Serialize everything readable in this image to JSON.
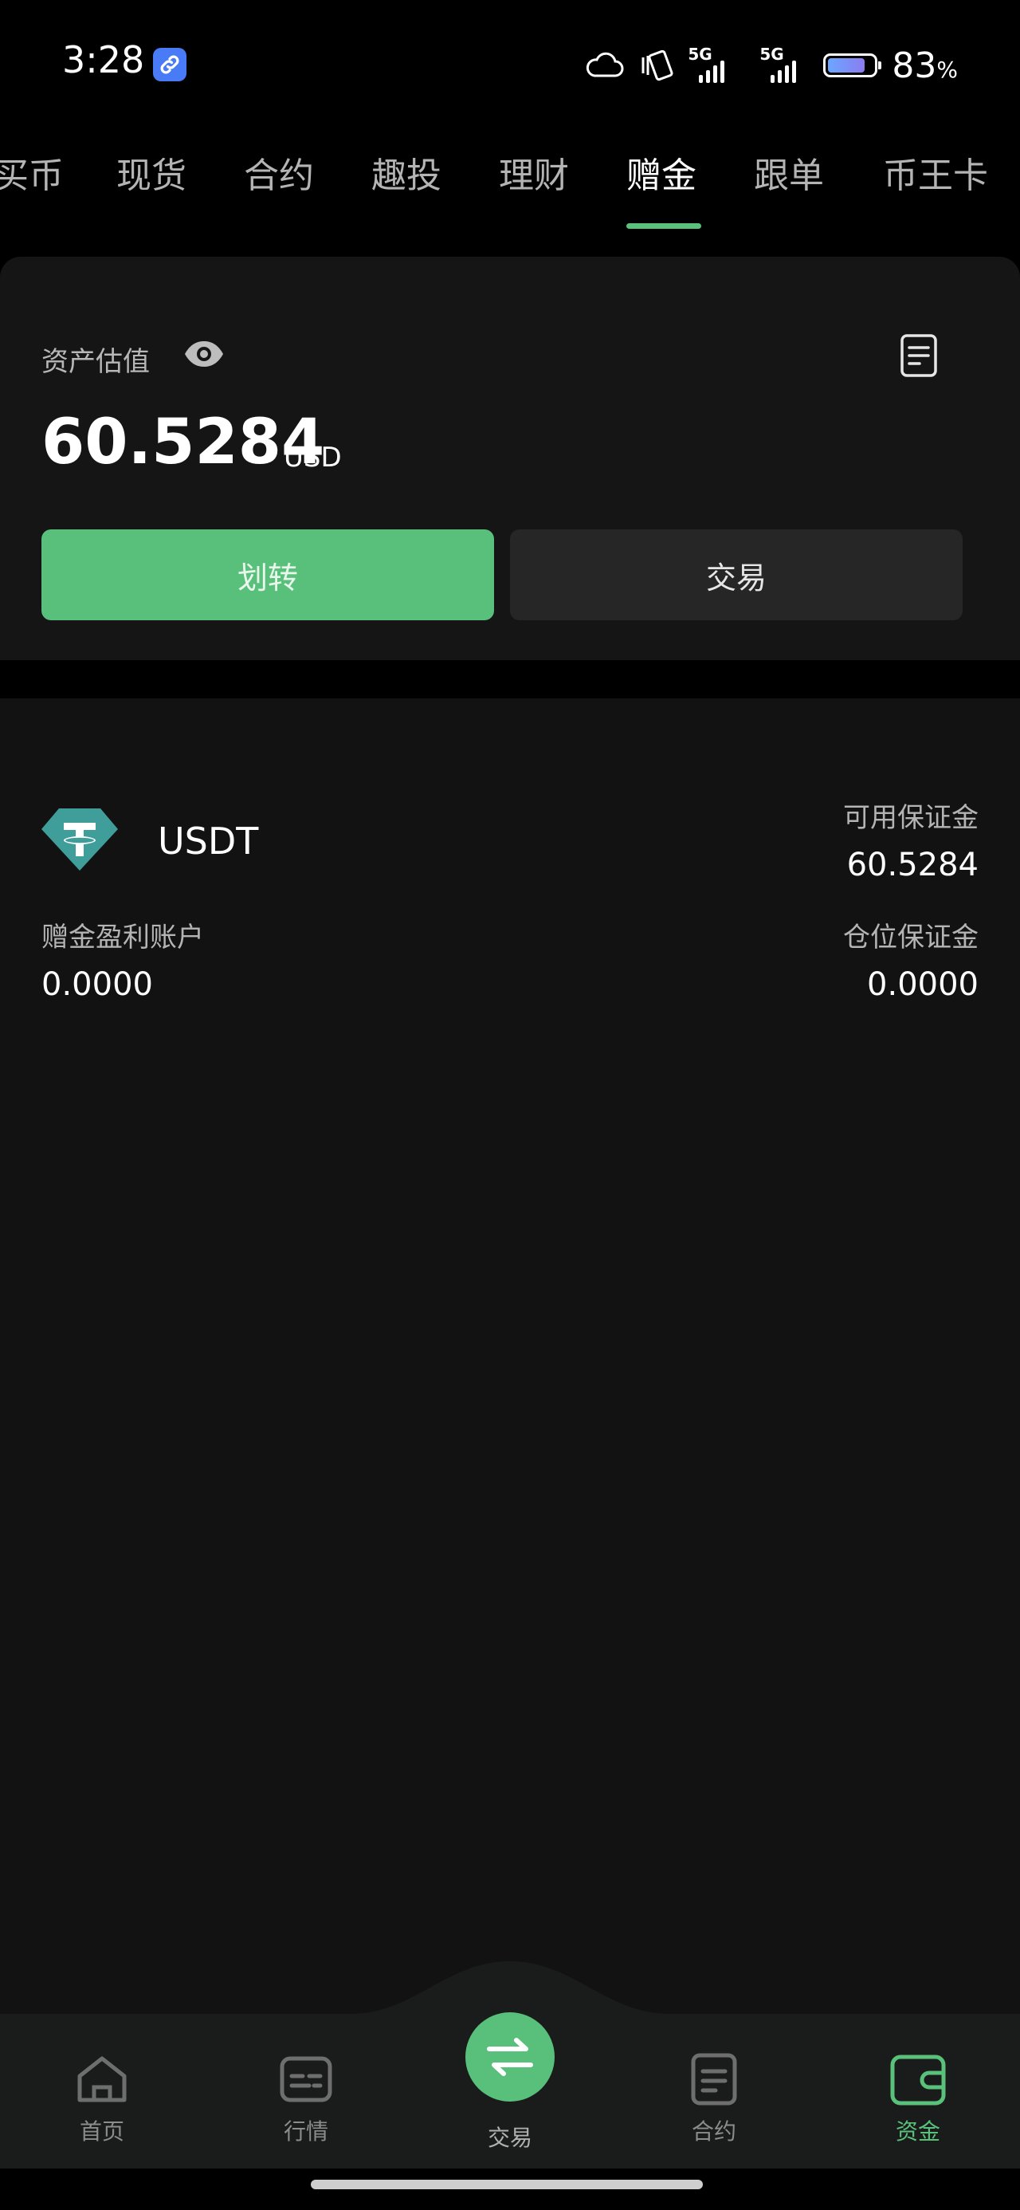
{
  "status_bar": {
    "time": "3:28",
    "signal_1": "5G",
    "signal_2": "5G",
    "battery_pct": "83",
    "battery_unit": "%",
    "battery_level": 0.83
  },
  "tabs": [
    {
      "label": "买币"
    },
    {
      "label": "现货"
    },
    {
      "label": "合约"
    },
    {
      "label": "趣投"
    },
    {
      "label": "理财"
    },
    {
      "label": "赠金",
      "active": true
    },
    {
      "label": "跟单"
    },
    {
      "label": "币王卡"
    }
  ],
  "asset": {
    "label": "资产估值",
    "value": "60.5284",
    "unit": "USD",
    "transfer_label": "划转",
    "trade_label": "交易"
  },
  "coin": {
    "name": "USDT",
    "available_margin_label": "可用保证金",
    "available_margin_value": "60.5284",
    "bonus_profit_label": "赠金盈利账户",
    "bonus_profit_value": "0.0000",
    "position_margin_label": "仓位保证金",
    "position_margin_value": "0.0000"
  },
  "bottom_nav": {
    "home": "首页",
    "market": "行情",
    "trade": "交易",
    "futures": "合约",
    "assets": "资金"
  },
  "colors": {
    "accent": "#58c07a",
    "background": "#121212",
    "card": "#151515",
    "muted_text": "#b4b4b4"
  },
  "icons": [
    "link-icon",
    "cloud-icon",
    "vibrate-icon",
    "eye-icon",
    "record-icon",
    "usdt-icon",
    "home-icon",
    "market-icon",
    "swap-icon",
    "futures-icon",
    "wallet-icon"
  ]
}
